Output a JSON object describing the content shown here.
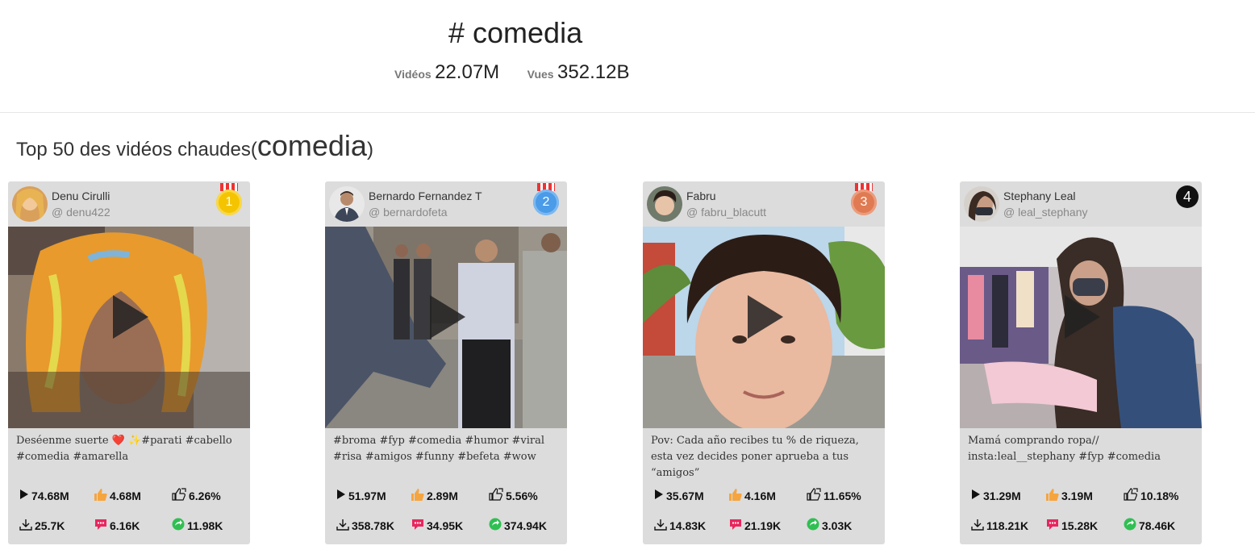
{
  "hashtag": {
    "title": "# comedia",
    "videos_label": "Vidéos",
    "videos_value": "22.07M",
    "views_label": "Vues",
    "views_value": "352.12B"
  },
  "section": {
    "title_prefix": "Top 50 des vidéos chaudes(",
    "title_tag": "comedia",
    "title_suffix": ")"
  },
  "cards": [
    {
      "rank": "1",
      "medal_color": "#f5c400",
      "name": "Denu Cirulli",
      "handle": "@ denu422",
      "description": "Deséenme suerte ❤️ ✨#parati #cabello #comedia #amarella",
      "plays": "74.68M",
      "likes": "4.68M",
      "engagement": "6.26%",
      "downloads": "25.7K",
      "comments": "6.16K",
      "shares": "11.98K"
    },
    {
      "rank": "2",
      "medal_color": "#4a9be8",
      "name": "Bernardo Fernandez T",
      "handle": "@ bernardofeta",
      "description": "#broma #fyp #comedia #humor #viral #risa #amigos #funny #befeta #wow",
      "plays": "51.97M",
      "likes": "2.89M",
      "engagement": "5.56%",
      "downloads": "358.78K",
      "comments": "34.95K",
      "shares": "374.94K"
    },
    {
      "rank": "3",
      "medal_color": "#e07a52",
      "name": "Fabru",
      "handle": "@ fabru_blacutt",
      "description": "Pov: Cada año recibes tu % de riqueza, esta vez decides poner aprueba a tus “amigos”",
      "plays": "35.67M",
      "likes": "4.16M",
      "engagement": "11.65%",
      "downloads": "14.83K",
      "comments": "21.19K",
      "shares": "3.03K"
    },
    {
      "rank": "4",
      "medal_color": "#111111",
      "name": "Stephany Leal",
      "handle": "@ leal_stephany",
      "description": "Mamá comprando ropa// insta:leal__stephany #fyp #comedia",
      "plays": "31.29M",
      "likes": "3.19M",
      "engagement": "10.18%",
      "downloads": "118.21K",
      "comments": "15.28K",
      "shares": "78.46K"
    }
  ]
}
